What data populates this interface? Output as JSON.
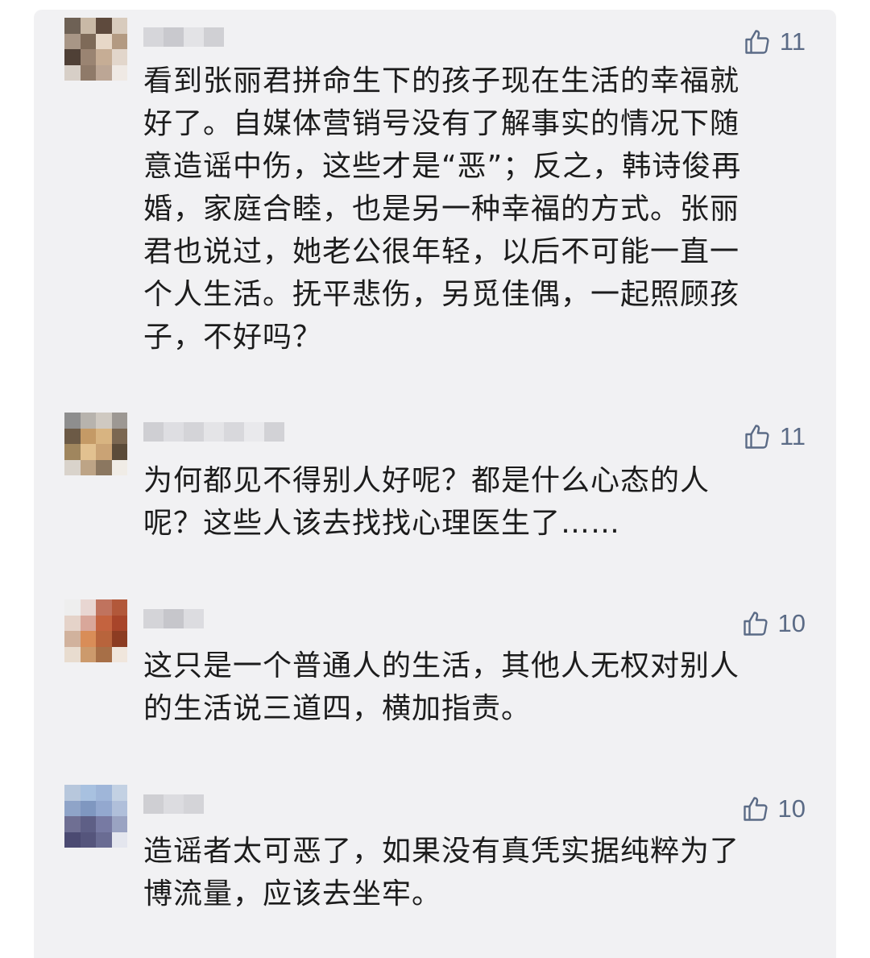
{
  "comments": [
    {
      "likes": "11",
      "text": "看到张丽君拼命生下的孩子现在生活的幸福就\n好了。自媒体营销号没有了解事实的情况下随\n意造谣中伤，这些才是“恶”；反之，韩诗俊再\n婚，家庭合睦，也是另一种幸福的方式。张丽\n君也说过，她老公很年轻，以后不可能一直一\n个人生活。抚平悲伤，另觅佳偶，一起照顾孩\n子，不好吗？",
      "avatar_colors": [
        "#6e6155",
        "#c9b9a6",
        "#5e4a3d",
        "#d8cbbd",
        "#a89686",
        "#7e6a58",
        "#e7d8c8",
        "#b39a82",
        "#4f4036",
        "#9a8472",
        "#c6ad95",
        "#e2d6cb",
        "#d7cfc7",
        "#8f7a69",
        "#bca695",
        "#efe9e4"
      ],
      "name_colors": [
        "#d6d6da",
        "#c9c9ce",
        "#e3e3e6",
        "#d0d0d4"
      ]
    },
    {
      "likes": "11",
      "text": "为何都见不得别人好呢？都是什么心态的人\n呢？这些人该去找找心理医生了……",
      "avatar_colors": [
        "#8e8e8e",
        "#b7b3ad",
        "#cfc9c1",
        "#9d9893",
        "#6c5a46",
        "#c49a66",
        "#d8b481",
        "#7b6751",
        "#a0865e",
        "#e2c190",
        "#caa375",
        "#5b4b39",
        "#d9d3cb",
        "#bda486",
        "#8b7760",
        "#f0ece6"
      ],
      "name_colors": [
        "#cfcfd3",
        "#dedee2",
        "#d4d4d8",
        "#e4e4e7",
        "#d8d8dc",
        "#e9e9ec",
        "#d2d2d6"
      ]
    },
    {
      "likes": "10",
      "text": "这只是一个普通人的生活，其他人无权对别人\n的生活说三道四，横加指责。",
      "avatar_colors": [
        "#eeeeee",
        "#e8d6d2",
        "#c0735e",
        "#b2583a",
        "#e5d3c9",
        "#d9a79a",
        "#c4633f",
        "#a8452a",
        "#d1b29d",
        "#d98d58",
        "#b8643c",
        "#8c3c22",
        "#e8dccf",
        "#cc9a6c",
        "#a76f47",
        "#f0e6dc"
      ],
      "name_colors": [
        "#d4d4d8",
        "#c6c6cb",
        "#dcdce0"
      ]
    },
    {
      "likes": "10",
      "text": "造谣者太可恶了，如果没有真凭实据纯粹为了\n博流量，应该去坐牢。",
      "avatar_colors": [
        "#b7c7dc",
        "#a8c1e0",
        "#9fb6d9",
        "#c3d1e3",
        "#8fa4c8",
        "#7f97c0",
        "#93a8cf",
        "#b0bfda",
        "#6f6f93",
        "#5e5f86",
        "#777aa3",
        "#9aa3c2",
        "#4b4a72",
        "#55557c",
        "#6a6c93",
        "#e4e6ee"
      ],
      "name_colors": [
        "#cfcfd3",
        "#dcdce0",
        "#d4d4d8"
      ]
    }
  ]
}
